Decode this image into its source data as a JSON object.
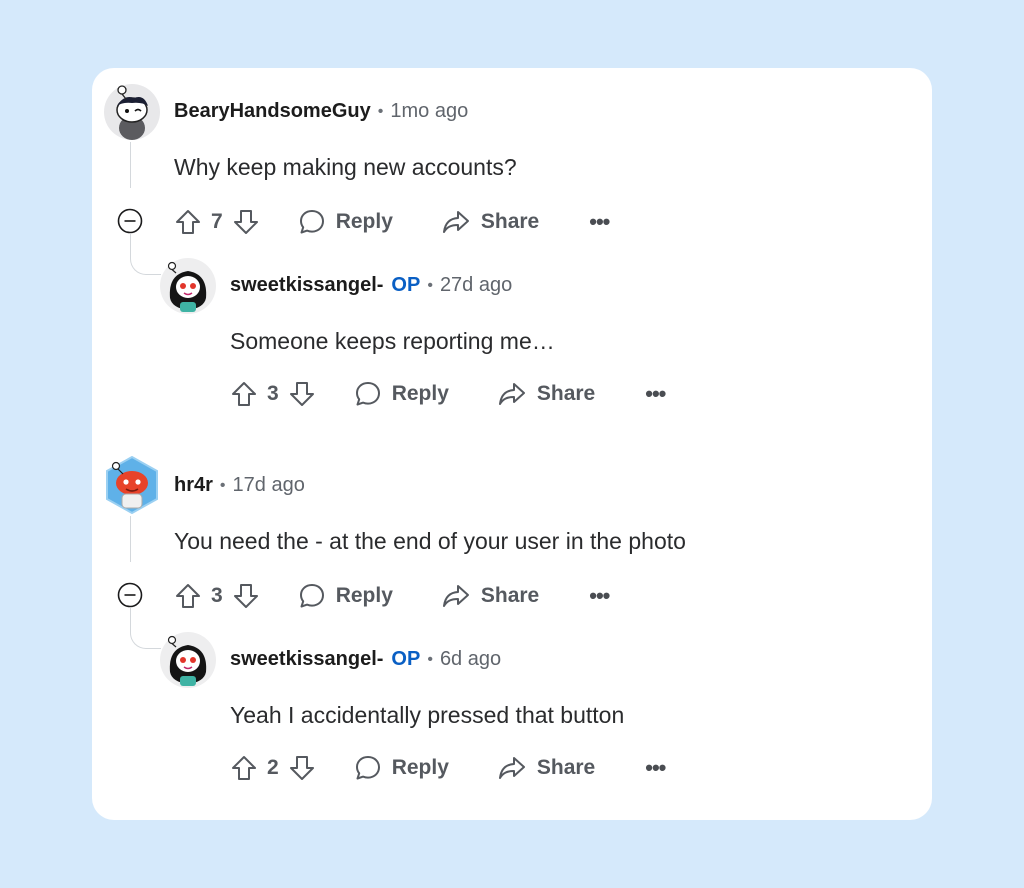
{
  "comments": [
    {
      "username": "BearyHandsomeGuy",
      "time": "1mo ago",
      "body": "Why keep making new accounts?",
      "votes": "7",
      "reply_label": "Reply",
      "share_label": "Share",
      "more_label": "•••",
      "replies": [
        {
          "username": "sweetkissangel-",
          "badge": "OP",
          "time": "27d ago",
          "body": "Someone keeps reporting me…",
          "votes": "3",
          "reply_label": "Reply",
          "share_label": "Share",
          "more_label": "•••"
        }
      ]
    },
    {
      "username": "hr4r",
      "time": "17d ago",
      "body": "You need the - at the end of your user in the photo",
      "votes": "3",
      "reply_label": "Reply",
      "share_label": "Share",
      "more_label": "•••",
      "replies": [
        {
          "username": "sweetkissangel-",
          "badge": "OP",
          "time": "6d ago",
          "body": "Yeah I accidentally pressed that button",
          "votes": "2",
          "reply_label": "Reply",
          "share_label": "Share",
          "more_label": "•••"
        }
      ]
    }
  ],
  "separator": "•",
  "colors": {
    "background": "#d5e9fb",
    "card": "#ffffff",
    "op_badge": "#0a5fc4",
    "meta_text": "#60656c"
  }
}
